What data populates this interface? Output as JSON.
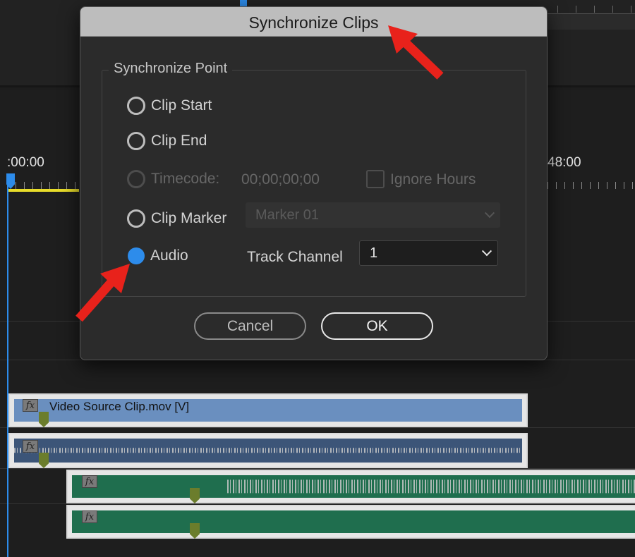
{
  "dialog": {
    "title": "Synchronize Clips",
    "group_label": "Synchronize Point",
    "options": {
      "clip_start": "Clip Start",
      "clip_end": "Clip End",
      "timecode": "Timecode:",
      "timecode_value": "00;00;00;00",
      "ignore_hours": "Ignore Hours",
      "clip_marker": "Clip Marker",
      "marker_value": "Marker 01",
      "audio": "Audio",
      "track_channel_label": "Track Channel",
      "track_channel_value": "1"
    },
    "selected_option": "audio",
    "buttons": {
      "cancel": "Cancel",
      "ok": "OK"
    }
  },
  "timeline": {
    "time_start": ":00:00",
    "time_end": "48:00",
    "clips": {
      "video_name": "Video Source Clip.mov [V]",
      "fx_label": "fx"
    }
  },
  "colors": {
    "accent": "#2d8ceb",
    "annotation_arrow": "#e8221b",
    "video_clip": "#6a8fbf",
    "audio_clip": "#3c5578",
    "external_audio_clip": "#1f6e4e",
    "in_out_bar": "#e8dc2a"
  },
  "icons": [
    "radio-button",
    "checkbox",
    "chevron-down-icon",
    "fx-badge-icon",
    "marker-icon",
    "playhead-icon",
    "annotation-arrow-icon"
  ]
}
